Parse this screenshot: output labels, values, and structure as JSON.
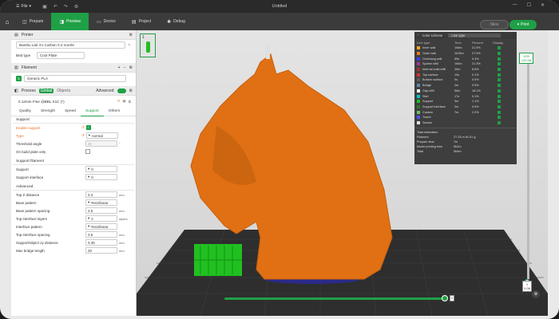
{
  "titlebar": {
    "file_label": "File",
    "title": "Untitled"
  },
  "tabs": [
    {
      "label": "Prepare"
    },
    {
      "label": "Preview"
    },
    {
      "label": "Device"
    },
    {
      "label": "Project"
    },
    {
      "label": "Debug"
    }
  ],
  "actions": {
    "slice": "Slice",
    "print": "Print"
  },
  "printer": {
    "section": "Printer",
    "name": "Bambu Lab X1 Carbon 0.4 nozzle",
    "bed_label": "Bed type",
    "bed_value": "Cool Plate"
  },
  "filament": {
    "section": "Filament",
    "index": "1",
    "name": "Generic PLA"
  },
  "process": {
    "section": "Process",
    "global": "Global",
    "objects": "Objects",
    "advanced": "Advanced",
    "profile": "0.12mm Fine @BBL X1C (*)"
  },
  "subtabs": [
    "Quality",
    "Strength",
    "Speed",
    "Support",
    "Others"
  ],
  "support": {
    "group": "Support",
    "enable": {
      "label": "Enable support"
    },
    "type": {
      "label": "Type",
      "value": "normal"
    },
    "threshold": {
      "label": "Threshold angle",
      "value": "30",
      "unit": "°"
    },
    "build_plate": {
      "label": "On build plate only"
    }
  },
  "support_filament": {
    "group": "Support filament",
    "support": {
      "label": "Support",
      "value": "0"
    },
    "interface": {
      "label": "Support interface",
      "value": "0"
    }
  },
  "advanced": {
    "group": "Advanced",
    "rows": [
      {
        "label": "Top Z distance",
        "value": "0.2",
        "unit": "mm"
      },
      {
        "label": "Base pattern",
        "value": "Rectilinear",
        "unit": ""
      },
      {
        "label": "Base pattern spacing",
        "value": "2.5",
        "unit": "mm"
      },
      {
        "label": "Top interface layers",
        "value": "2",
        "unit": "layers"
      },
      {
        "label": "Interface pattern",
        "value": "Rectilinear",
        "unit": ""
      },
      {
        "label": "Top interface spacing",
        "value": "0.5",
        "unit": "mm"
      },
      {
        "label": "Support/object xy distance",
        "value": "0.35",
        "unit": "mm"
      },
      {
        "label": "Max bridge length",
        "value": "20",
        "unit": "mm"
      }
    ]
  },
  "plate": {
    "number": "1"
  },
  "legend": {
    "color_scheme": "Color scheme",
    "scheme_value": "Line type",
    "cols": [
      "Line type",
      "Time",
      "Percent",
      "Display"
    ],
    "rows": [
      {
        "name": "Inner wall",
        "time": "1h8m",
        "percent": "21.9%",
        "color": "#f5a623"
      },
      {
        "name": "Outer wall",
        "time": "1h25m",
        "percent": "27.5%",
        "color": "#e87a20"
      },
      {
        "name": "Overhang wall",
        "time": "59s",
        "percent": "0.3%",
        "color": "#3c3cff"
      },
      {
        "name": "Sparse infill",
        "time": "1h6m",
        "percent": "21.3%",
        "color": "#9e3c8e"
      },
      {
        "name": "Internal solid infill",
        "time": "20m",
        "percent": "6.6%",
        "color": "#a03030"
      },
      {
        "name": "Top surface",
        "time": "13s",
        "percent": "0.1%",
        "color": "#d83030"
      },
      {
        "name": "Bottom surface",
        "time": "0s",
        "percent": "0.0%",
        "color": "#5a5a5a"
      },
      {
        "name": "Bridge",
        "time": "2m",
        "percent": "0.5%",
        "color": "#5a8ab0"
      },
      {
        "name": "Gap infill",
        "time": "56m",
        "percent": "18.1%",
        "color": "#ffffff"
      },
      {
        "name": "Skirt",
        "time": "17s",
        "percent": "0.1%",
        "color": "#00c8c8"
      },
      {
        "name": "Support",
        "time": "3m",
        "percent": "1.1%",
        "color": "#20c020"
      },
      {
        "name": "Support interface",
        "time": "2m",
        "percent": "0.6%",
        "color": "#2a7a2a"
      },
      {
        "name": "Custom",
        "time": "7m",
        "percent": "2.2%",
        "color": "#6ac06a"
      },
      {
        "name": "Travel",
        "time": "",
        "percent": "",
        "color": "#5050ff"
      },
      {
        "name": "Seams",
        "time": "",
        "percent": "",
        "color": "#e0e0e0"
      }
    ],
    "total_label": "Total estimation",
    "estimates": [
      {
        "k": "Filament",
        "v": "27.33 m    81.51 g"
      },
      {
        "k": "Prepare time",
        "v": "7m"
      },
      {
        "k": "Model printing time",
        "v": "5h2m"
      },
      {
        "k": "Total",
        "v": "5h9m"
      }
    ]
  },
  "layer_slider": {
    "top_line1": "10%",
    "top_line2": "120.08",
    "bottom_line1": "1",
    "bottom_line2": "0.08"
  },
  "move_slider": {
    "value": "2"
  },
  "colors": {
    "accent": "#1fa046",
    "model": "#e07013",
    "support": "#20c020"
  }
}
